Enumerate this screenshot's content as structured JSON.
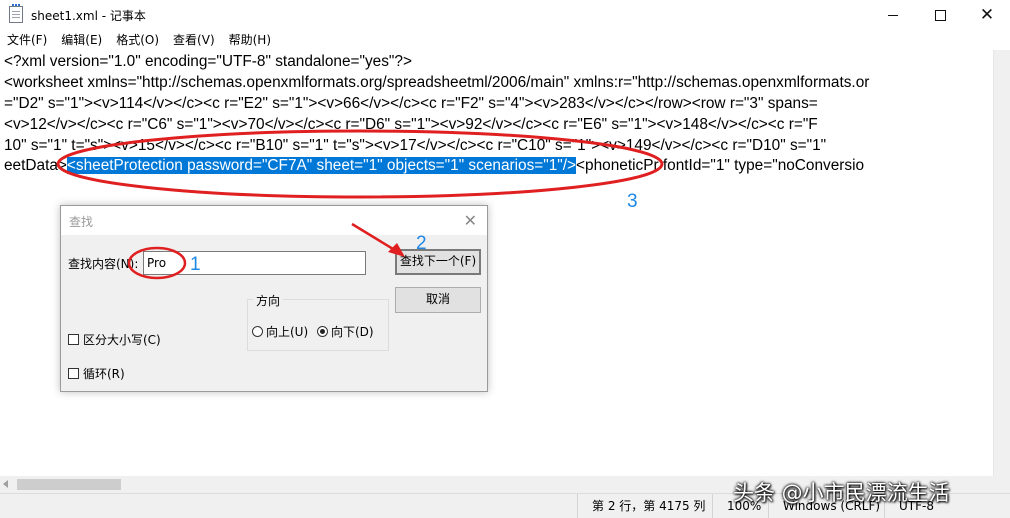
{
  "window": {
    "title": "sheet1.xml - 记事本",
    "icon": "notepad-icon"
  },
  "menu": [
    "文件(F)",
    "编辑(E)",
    "格式(O)",
    "查看(V)",
    "帮助(H)"
  ],
  "editor": {
    "lines": [
      "<?xml version=\"1.0\" encoding=\"UTF-8\" standalone=\"yes\"?>",
      "<worksheet xmlns=\"http://schemas.openxmlformats.org/spreadsheetml/2006/main\" xmlns:r=\"http://schemas.openxmlformats.or",
      "=\"D2\" s=\"1\"><v>114</v></c><c r=\"E2\" s=\"1\"><v>66</v></c><c r=\"F2\" s=\"4\"><v>283</v></c></row><row r=\"3\" spans=",
      "<v>12</v></c><c r=\"C6\" s=\"1\"><v>70</v></c><c r=\"D6\" s=\"1\"><v>92</v></c><c r=\"E6\" s=\"1\"><v>148</v></c><c r=\"F",
      "10\" s=\"1\" t=\"s\"><v>15</v></c><c r=\"B10\" s=\"1\" t=\"s\"><v>17</v></c><c r=\"C10\" s=\"1\"><v>149</v></c><c r=\"D10\" s=\"1\""
    ],
    "line5": {
      "before": "eetData>",
      "selected": "<sheetProtection password=\"CF7A\" sheet=\"1\" objects=\"1\" scenarios=\"1\"/>",
      "after": "<phoneticPr fontId=\"1\" type=\"noConversio"
    },
    "selection_color": "#0078d7"
  },
  "status": {
    "position": "第 2 行，第 4175 列",
    "zoom": "100%",
    "eol": "Windows (CRLF)",
    "encoding": "UTF-8"
  },
  "watermark": "头条 @小市民漂流生活",
  "find_dialog": {
    "title": "查找",
    "find_label": "查找内容(N):",
    "find_value": "Pro",
    "find_next": "查找下一个(F)",
    "cancel": "取消",
    "direction_title": "方向",
    "up": "向上(U)",
    "down": "向下(D)",
    "direction_selected": "down",
    "match_case": "区分大小写(C)",
    "match_case_checked": false,
    "wrap": "循环(R)",
    "wrap_checked": false
  },
  "annotations": {
    "labels": [
      "1",
      "2",
      "3"
    ],
    "color_ellipse": "#e02020",
    "color_number": "#1e88e5"
  }
}
